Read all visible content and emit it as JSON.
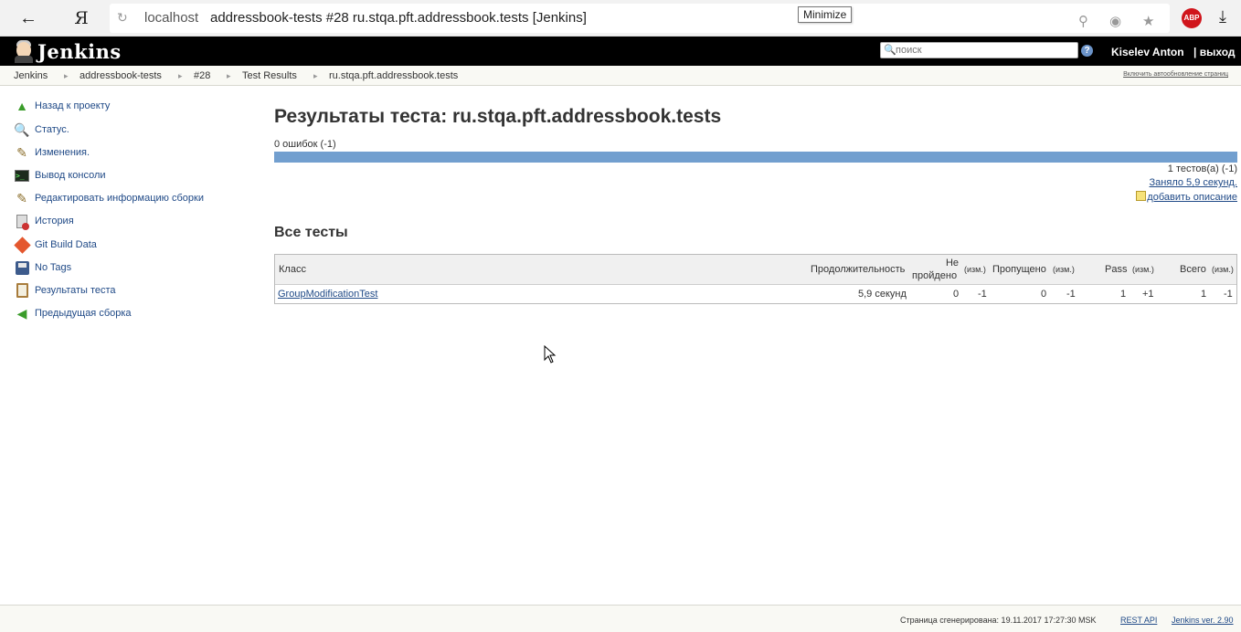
{
  "browser": {
    "host": "localhost",
    "tab_title": "addressbook-tests #28 ru.stqa.pft.addressbook.tests [Jenkins]",
    "tooltip": "Minimize",
    "yandex_glyph": "Я",
    "adblock_label": "ABP"
  },
  "header": {
    "logo_text": "Jenkins",
    "search_placeholder": "поиск",
    "help_label": "?",
    "user_name": "Kiselev Anton",
    "logout_label": "| выход"
  },
  "breadcrumbs": [
    "Jenkins",
    "addressbook-tests",
    "#28",
    "Test Results",
    "ru.stqa.pft.addressbook.tests"
  ],
  "autorefresh_label": "Включить автообновление страниц",
  "sidebar": {
    "items": [
      {
        "label": "Назад к проекту",
        "icon": "up-arrow-icon"
      },
      {
        "label": "Статус.",
        "icon": "magnifier-icon"
      },
      {
        "label": "Изменения.",
        "icon": "notepad-icon"
      },
      {
        "label": "Вывод консоли",
        "icon": "terminal-icon"
      },
      {
        "label": "Редактировать информацию сборки",
        "icon": "edit-notepad-icon"
      },
      {
        "label": "История",
        "icon": "history-icon"
      },
      {
        "label": "Git Build Data",
        "icon": "git-icon"
      },
      {
        "label": "No Tags",
        "icon": "floppy-icon"
      },
      {
        "label": "Результаты теста",
        "icon": "clipboard-icon"
      },
      {
        "label": "Предыдущая сборка",
        "icon": "left-arrow-icon"
      }
    ]
  },
  "main": {
    "title": "Результаты теста: ru.stqa.pft.addressbook.tests",
    "fail_count": "0 ошибок (-1)",
    "progress_pass_fraction": 1.0,
    "test_count": "1 тестов(а) (-1)",
    "duration_link": "Заняло 5,9 секунд.",
    "add_description": "добавить описание",
    "section_title": "Все тесты",
    "table": {
      "headers": {
        "class": "Класс",
        "duration": "Продолжительность",
        "failed_line1": "Не",
        "failed_line2": "пройдено",
        "diff": "(изм.)",
        "skipped": "Пропущено",
        "pass": "Pass",
        "total": "Всего"
      },
      "rows": [
        {
          "class": "GroupModificationTest",
          "duration": "5,9 секунд",
          "failed": "0",
          "failed_diff": "-1",
          "skipped": "0",
          "skipped_diff": "-1",
          "pass": "1",
          "pass_diff": "+1",
          "total": "1",
          "total_diff": "-1"
        }
      ]
    }
  },
  "footer": {
    "generated": "Страница сгенерирована: 19.11.2017 17:27:30 MSK",
    "rest_api": "REST API",
    "version": "Jenkins ver. 2.90"
  },
  "colors": {
    "header_bg": "#000000",
    "progress_pass": "#729fcf",
    "link": "#204a87"
  }
}
